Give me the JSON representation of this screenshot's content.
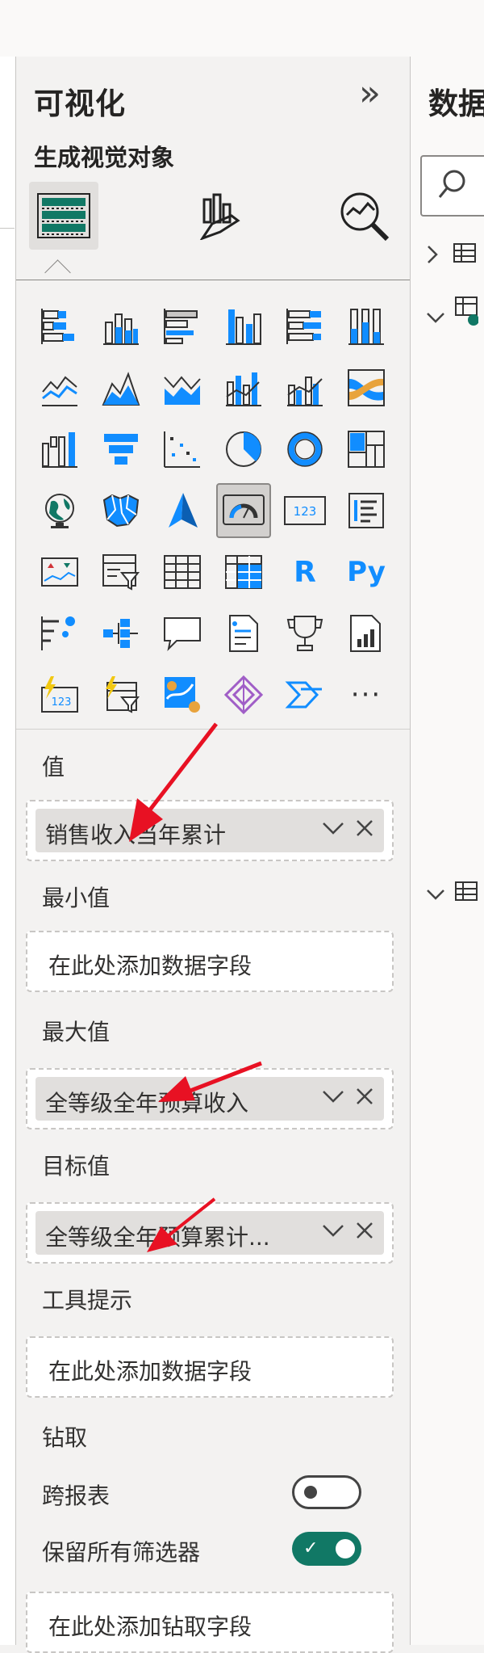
{
  "panel": {
    "title": "可视化",
    "collapse_glyph": "»",
    "subtitle": "生成视觉对象",
    "tabs": [
      {
        "name": "build-visual-tab-icon",
        "active": true
      },
      {
        "name": "format-visual-tab-icon",
        "active": false
      },
      {
        "name": "analytics-tab-icon",
        "active": false
      }
    ],
    "visual_icons": [
      [
        "stacked-bar-chart-icon",
        "stacked-column-chart-icon",
        "clustered-bar-chart-icon",
        "clustered-column-chart-icon",
        "100-stacked-bar-chart-icon",
        "100-stacked-column-chart-icon"
      ],
      [
        "line-chart-icon",
        "area-chart-icon",
        "stacked-area-chart-icon",
        "line-and-stacked-column-chart-icon",
        "line-and-clustered-column-chart-icon",
        "ribbon-chart-icon"
      ],
      [
        "waterfall-chart-icon",
        "funnel-chart-icon",
        "scatter-chart-icon",
        "pie-chart-icon",
        "donut-chart-icon",
        "treemap-icon"
      ],
      [
        "map-icon",
        "filled-map-icon",
        "azure-map-icon",
        "gauge-icon",
        "card-icon",
        "multi-row-card-icon"
      ],
      [
        "kpi-icon",
        "slicer-icon",
        "table-icon",
        "matrix-icon",
        "r-script-visual-icon",
        "python-visual-icon"
      ],
      [
        "key-influencers-icon",
        "decomposition-tree-icon",
        "qa-icon",
        "smart-narrative-icon",
        "goals-trophy-icon",
        "paginated-report-icon"
      ],
      [
        "power-apps-icon",
        "power-automate-slicer-icon",
        "arcgis-map-icon",
        "powerapps-diamond-icon",
        "power-automate-icon",
        "more-visuals-icon"
      ]
    ],
    "more_label": "···",
    "r_label": "R",
    "py_label": "Py",
    "card_label": "123"
  },
  "fields": {
    "value": {
      "label": "值",
      "chip": "销售收入当年累计"
    },
    "min": {
      "label": "最小值",
      "placeholder": "在此处添加数据字段"
    },
    "max": {
      "label": "最大值",
      "chip": "全等级全年预算收入"
    },
    "target": {
      "label": "目标值",
      "chip": "全等级全年预算累计..."
    },
    "tooltip": {
      "label": "工具提示",
      "placeholder": "在此处添加数据字段"
    }
  },
  "drill": {
    "label": "钻取",
    "cross_report": {
      "label": "跨报表",
      "state": "off"
    },
    "keep_filters": {
      "label": "保留所有筛选器",
      "state": "on"
    },
    "placeholder": "在此处添加钻取字段"
  },
  "data_pane": {
    "title": "数据",
    "search_icon": "search-icon",
    "rows": [
      "›",
      "⌄",
      "⌄"
    ]
  },
  "colors": {
    "accent_green": "#117865",
    "arrow_red": "#e81123",
    "chart_blue": "#118dff"
  }
}
